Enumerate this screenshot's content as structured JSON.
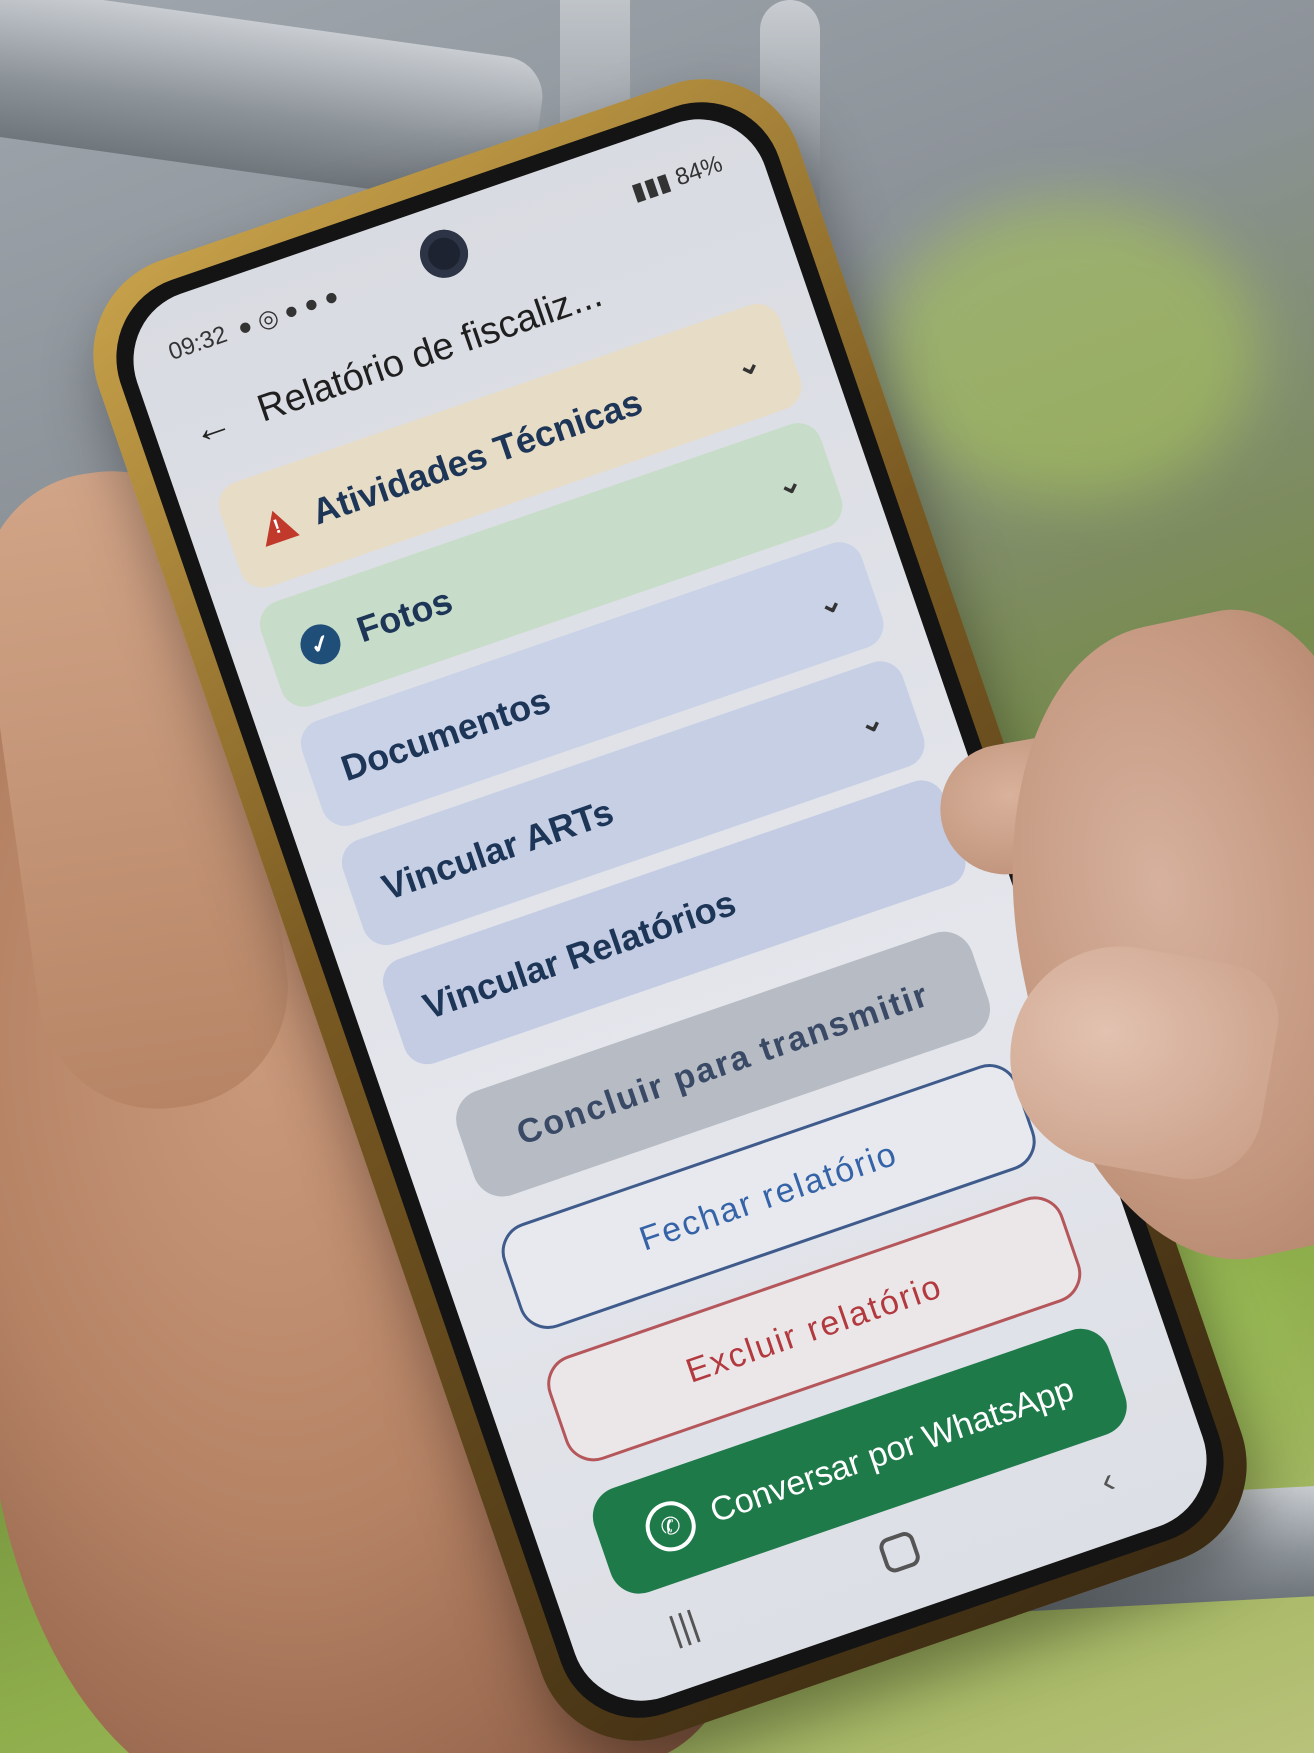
{
  "status_bar": {
    "time": "09:32",
    "battery": "84%"
  },
  "app_bar": {
    "title": "Relatório de fiscaliz..."
  },
  "sections": [
    {
      "label": "Atividades Técnicas",
      "state": "warning"
    },
    {
      "label": "Fotos",
      "state": "complete"
    },
    {
      "label": "Documentos",
      "state": "none"
    },
    {
      "label": "Vincular ARTs",
      "state": "none"
    },
    {
      "label": "Vincular Relatórios",
      "state": "none"
    }
  ],
  "buttons": {
    "concluir": "Concluir para transmitir",
    "fechar": "Fechar relatório",
    "excluir": "Excluir relatório",
    "whatsapp": "Conversar por WhatsApp"
  },
  "colors": {
    "warning": "#c0392b",
    "complete": "#1f4e79",
    "whatsapp": "#1f7a4a",
    "fechar_border": "#3f5b8c",
    "excluir_border": "#b5565a"
  }
}
